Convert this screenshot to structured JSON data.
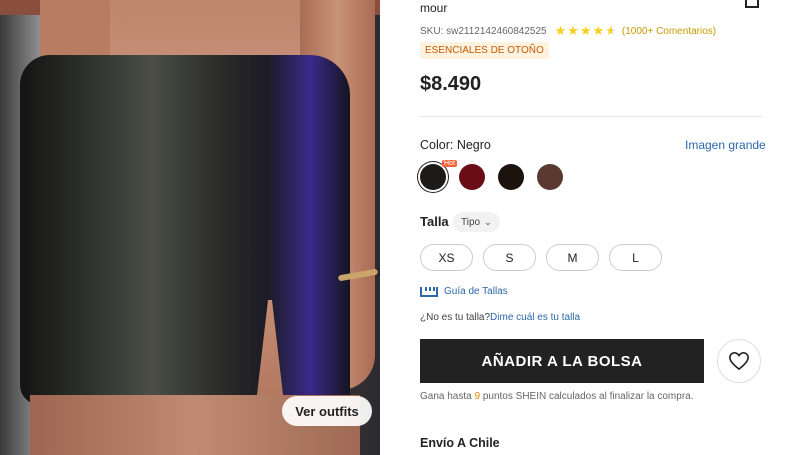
{
  "product": {
    "title_tail": "mour",
    "sku": "SKU: sw2112142460842525",
    "rating_stars": 4.5,
    "reviews": "(1000+ Comentarios)",
    "badge": "ESENCIALES DE OTOÑO",
    "price": "$8.490"
  },
  "color": {
    "label": "Color:",
    "value": "Negro",
    "big_image_link": "Imagen grande",
    "hot_tag": "Hot",
    "swatches": [
      {
        "name": "black",
        "hex": "#1e1a18"
      },
      {
        "name": "burgundy",
        "hex": "#6a0d14"
      },
      {
        "name": "dark-brown",
        "hex": "#1c120e"
      },
      {
        "name": "brown",
        "hex": "#5a3a30"
      }
    ]
  },
  "size": {
    "label": "Talla",
    "type_button": "Tipo",
    "options": [
      "XS",
      "S",
      "M",
      "L"
    ],
    "guide_link": "Guía de Tallas",
    "fit_question": "¿No es tu talla?",
    "fit_link": "Dime cuál es tu talla"
  },
  "actions": {
    "add_to_bag": "AÑADIR A LA BOLSA",
    "outfits": "Ver outfits"
  },
  "points": {
    "prefix": "Gana hasta",
    "number": "9",
    "suffix": "puntos SHEIN calculados al finalizar la compra."
  },
  "shipping": {
    "title": "Envío A Chile"
  }
}
